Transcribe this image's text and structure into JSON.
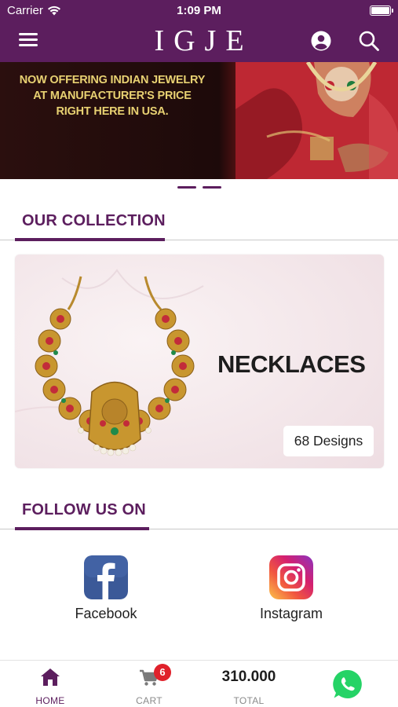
{
  "status_bar": {
    "carrier": "Carrier",
    "time": "1:09 PM"
  },
  "header": {
    "logo": "IGJE",
    "icons": [
      "menu-icon",
      "account-icon",
      "search-icon"
    ]
  },
  "banner": {
    "lines": [
      "NOW OFFERING INDIAN JEWELRY",
      "AT MANUFACTURER'S PRICE",
      "RIGHT HERE IN USA."
    ]
  },
  "carousel": {
    "count": 2,
    "active": 0
  },
  "collection": {
    "heading": "OUR COLLECTION",
    "card": {
      "title": "NECKLACES",
      "designs": "68 Designs"
    }
  },
  "follow": {
    "heading": "FOLLOW US ON",
    "links": [
      {
        "label": "Facebook",
        "icon": "facebook-icon"
      },
      {
        "label": "Instagram",
        "icon": "instagram-icon"
      }
    ]
  },
  "tabbar": {
    "home": "HOME",
    "cart": "CART",
    "cart_count": "6",
    "total_label": "TOTAL",
    "total_value": "310.000"
  },
  "colors": {
    "brand": "#5c1e5e",
    "gold_text": "#e8d172",
    "badge": "#e0212b",
    "whatsapp": "#25d366"
  }
}
